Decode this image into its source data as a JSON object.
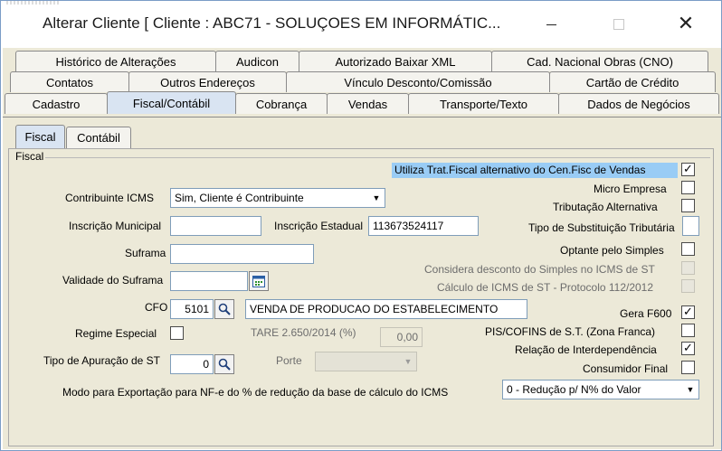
{
  "window": {
    "title": "Alterar Cliente [ Cliente : ABC71 - SOLUÇOES EM INFORMÁTIC...",
    "minimize_icon": "minimize-icon",
    "maximize_icon": "maximize-icon",
    "close_icon": "close-icon"
  },
  "tabs": {
    "row1": [
      "Histórico de Alterações",
      "Audicon",
      "Autorizado Baixar XML",
      "Cad. Nacional Obras (CNO)"
    ],
    "row2": [
      "Contatos",
      "Outros Endereços",
      "Vínculo Desconto/Comissão",
      "Cartão de Crédito"
    ],
    "row3": [
      "Cadastro",
      "Fiscal/Contábil",
      "Cobrança",
      "Vendas",
      "Transporte/Texto",
      "Dados de Negócios"
    ],
    "active": "Fiscal/Contábil"
  },
  "subtabs": [
    "Fiscal",
    "Contábil"
  ],
  "fiscal": {
    "group_label": "Fiscal",
    "contribuinte_icms_label": "Contribuinte ICMS",
    "contribuinte_icms_value": "Sim, Cliente é Contribuinte",
    "inscricao_municipal_label": "Inscrição Municipal",
    "inscricao_municipal_value": "",
    "inscricao_estadual_label": "Inscrição Estadual",
    "inscricao_estadual_value": "113673524117",
    "suframa_label": "Suframa",
    "suframa_value": "",
    "validade_suframa_label": "Validade do Suframa",
    "validade_suframa_value": "",
    "cfo_label": "CFO",
    "cfo_code": "5101",
    "cfo_description": "VENDA DE PRODUCAO DO ESTABELECIMENTO",
    "regime_especial_label": "Regime Especial",
    "tare_label": "TARE 2.650/2014 (%)",
    "tare_value": "0,00",
    "tipo_apuracao_label": "Tipo de Apuração de ST",
    "tipo_apuracao_value": "0",
    "porte_label": "Porte",
    "porte_value": "",
    "modo_exportacao_label": "Modo para Exportação para NF-e do % de redução da base de cálculo do ICMS",
    "modo_exportacao_value": "0 - Redução p/ N% do Valor"
  },
  "checks": [
    {
      "label": "Utiliza Trat.Fiscal alternativo do Cen.Fisc de Vendas",
      "checked": true,
      "disabled": false,
      "highlight": true
    },
    {
      "label": "Micro Empresa",
      "checked": false,
      "disabled": false
    },
    {
      "label": "Tributação Alternativa",
      "checked": false,
      "disabled": false
    },
    {
      "label": "Tipo de Substituição Tributária",
      "checked": false,
      "disabled": false,
      "input": true
    },
    {
      "label": "Optante pelo Simples",
      "checked": false,
      "disabled": false
    },
    {
      "label": "Considera desconto do Simples no ICMS de ST",
      "checked": false,
      "disabled": true
    },
    {
      "label": "Cálculo de ICMS de ST - Protocolo 112/2012",
      "checked": false,
      "disabled": true
    },
    {
      "label": "Gera F600",
      "checked": true,
      "disabled": false
    },
    {
      "label": "PIS/COFINS de S.T. (Zona Franca)",
      "checked": false,
      "disabled": false
    },
    {
      "label": "Relação de Interdependência",
      "checked": true,
      "disabled": false
    },
    {
      "label": "Consumidor Final",
      "checked": false,
      "disabled": false
    }
  ],
  "colors": {
    "panel": "#ece9d8",
    "highlight": "#99ccf5",
    "active_tab": "#d9e4f2"
  }
}
